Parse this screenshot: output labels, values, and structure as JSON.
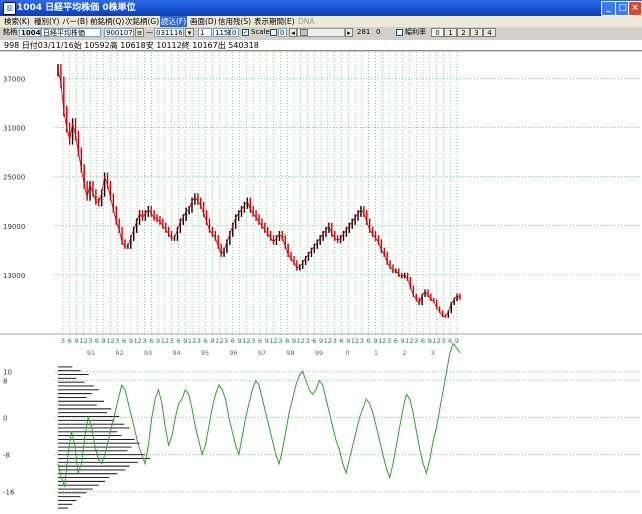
{
  "window": {
    "title": "1004 日経平均株価 0株単位",
    "icon": "chart-app-icon"
  },
  "menu": [
    "検索(K)",
    "種別(Y)",
    "バー(B)",
    "前銘柄(Q)",
    "次銘柄(G)",
    "読込(F)",
    "画面(D)",
    "信用残(S)",
    "表示期間(E)",
    "DNA"
  ],
  "toolbar": {
    "code_label": "銘柄",
    "code": "1004",
    "name": "日経平均株価",
    "date_from": "900107",
    "date_to": "031116",
    "step": "1",
    "count": "1150",
    "zero": "0",
    "scale_label": "Scale",
    "scale_value": "0",
    "num_281": "281",
    "num_0": "0",
    "ratio_label": "幅利率",
    "tabs": [
      "0",
      "1",
      "2",
      "3",
      "4"
    ]
  },
  "info": "998 日付03/11/16始 10592高 10618安 10112終 10167出 540318",
  "colors": {
    "price_up": "#000000",
    "price_down": "#d00000",
    "grid": "#20a040",
    "osc_line": "#30a030",
    "volume_bar": "#000000"
  },
  "chart_data": [
    {
      "type": "line",
      "title": "",
      "ylabel": "",
      "y_ticks": [
        "37000",
        "31000",
        "25000",
        "19000",
        "13000"
      ],
      "y_tick_values": [
        37000,
        31000,
        25000,
        19000,
        13000
      ],
      "x_month_labels": [
        "3",
        "6",
        "9",
        "12",
        "3",
        "6",
        "9",
        "12",
        "3",
        "6",
        "9",
        "12",
        "3",
        "6",
        "9",
        "12",
        "3",
        "6",
        "9",
        "12",
        "3",
        "6",
        "9",
        "12",
        "3",
        "6",
        "9",
        "12",
        "3",
        "6",
        "9",
        "12",
        "3",
        "6",
        "9",
        "12",
        "3",
        "6",
        "9",
        "12",
        "3",
        "6",
        "9",
        "12",
        "3",
        "6",
        "9",
        "12",
        "3",
        "6",
        "9",
        "12",
        "3",
        "6",
        "9",
        "12",
        "3",
        "6",
        "9"
      ],
      "x_year_labels": [
        "91",
        "92",
        "93",
        "94",
        "95",
        "96",
        "97",
        "98",
        "99",
        "0",
        "1",
        "2",
        "3"
      ],
      "series": [
        {
          "values": [
            38000,
            36500,
            33000,
            31000,
            29500,
            31500,
            30000,
            28000,
            26000,
            24000,
            22500,
            24000,
            23000,
            22000,
            21800,
            23000,
            25000,
            24000,
            22500,
            21000,
            19500,
            18500,
            17000,
            16500,
            16500,
            17500,
            18500,
            19500,
            20500,
            20000,
            20500,
            21000,
            20500,
            20000,
            19800,
            19500,
            19000,
            18500,
            18000,
            17500,
            17500,
            18500,
            19500,
            20000,
            20800,
            21000,
            22000,
            22500,
            22000,
            21500,
            20500,
            19500,
            18500,
            18000,
            17500,
            16500,
            15500,
            16000,
            17000,
            18000,
            19000,
            20000,
            20500,
            21000,
            21500,
            22000,
            21000,
            20500,
            20000,
            19500,
            19000,
            18500,
            18000,
            17500,
            17000,
            17500,
            18000,
            17500,
            16500,
            15500,
            15000,
            14500,
            13800,
            14000,
            14500,
            15000,
            15500,
            16000,
            16500,
            17000,
            17500,
            18000,
            18500,
            19000,
            18000,
            17500,
            17200,
            17500,
            18000,
            18500,
            19000,
            19500,
            20000,
            20500,
            21000,
            20500,
            19500,
            18500,
            18000,
            17500,
            17000,
            16000,
            15500,
            14500,
            14000,
            13500,
            13500,
            13000,
            12800,
            13000,
            12500,
            11500,
            10500,
            10000,
            9500,
            10500,
            11000,
            10500,
            10000,
            9800,
            9000,
            8500,
            8000,
            7900,
            8500,
            9500,
            10000,
            10500,
            10167
          ]
        }
      ]
    },
    {
      "type": "line",
      "title": "",
      "y_ticks": [
        "10",
        "8",
        "0",
        "-8",
        "-16"
      ],
      "y_tick_values": [
        10,
        8,
        0,
        -8,
        -16
      ],
      "series": [
        {
          "values": [
            -10,
            -13,
            -15,
            -8,
            -3,
            -6,
            -12,
            -10,
            -4,
            0,
            -2,
            -6,
            -9,
            -10,
            -8,
            -5,
            -2,
            1,
            4,
            7,
            6,
            3,
            0,
            -3,
            -6,
            -8,
            -10,
            -6,
            0,
            4,
            6,
            3,
            -2,
            -6,
            -4,
            0,
            3,
            4,
            6,
            5,
            2,
            -2,
            -5,
            -8,
            -6,
            -2,
            2,
            5,
            7,
            6,
            4,
            0,
            -3,
            -6,
            -8,
            -4,
            0,
            3,
            6,
            8,
            7,
            4,
            1,
            -2,
            -5,
            -8,
            -10,
            -7,
            -3,
            1,
            4,
            7,
            9,
            10,
            8,
            6,
            5,
            6,
            8,
            7,
            4,
            1,
            -2,
            -5,
            -7,
            -10,
            -12,
            -9,
            -6,
            -3,
            0,
            2,
            4,
            3,
            1,
            -2,
            -5,
            -8,
            -11,
            -13,
            -10,
            -6,
            -2,
            2,
            5,
            4,
            1,
            -3,
            -7,
            -10,
            -12,
            -9,
            -5,
            -2,
            2,
            6,
            10,
            14,
            16,
            15,
            14
          ]
        }
      ],
      "volume_profile": [
        14,
        22,
        30,
        18,
        26,
        35,
        40,
        33,
        28,
        45,
        38,
        52,
        48,
        60,
        55,
        65,
        70,
        58,
        62,
        75,
        80,
        72,
        68,
        85,
        90,
        78,
        70,
        66,
        58,
        50,
        46,
        40,
        34,
        28,
        22,
        18,
        14,
        10
      ]
    }
  ]
}
